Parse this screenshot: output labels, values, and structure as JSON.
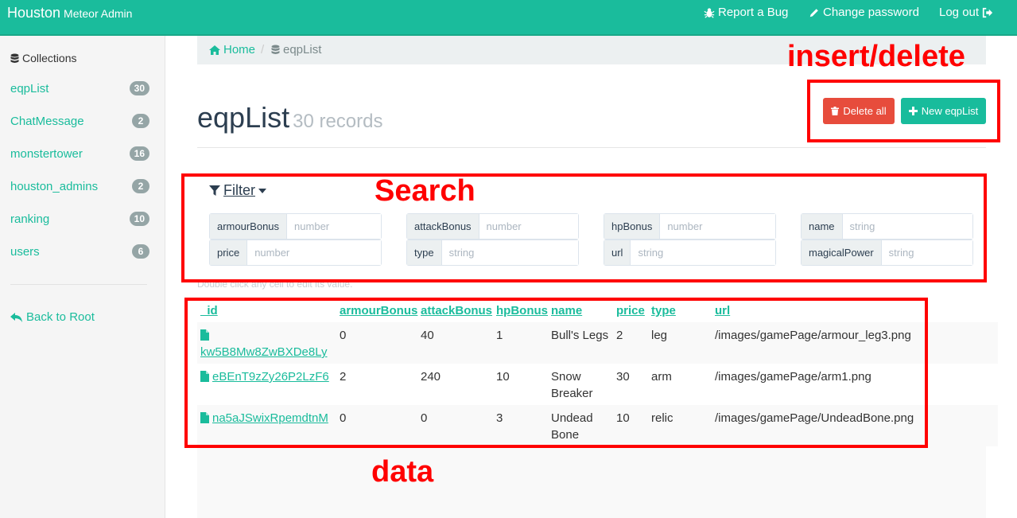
{
  "navbar": {
    "brand": "Houston",
    "brand_sub": "Meteor Admin",
    "report_bug": "Report a Bug",
    "change_password": "Change password",
    "logout": "Log out"
  },
  "sidebar": {
    "heading": "Collections",
    "items": [
      {
        "label": "eqpList",
        "count": "30"
      },
      {
        "label": "ChatMessage",
        "count": "2"
      },
      {
        "label": "monstertower",
        "count": "16"
      },
      {
        "label": "houston_admins",
        "count": "2"
      },
      {
        "label": "ranking",
        "count": "10"
      },
      {
        "label": "users",
        "count": "6"
      }
    ],
    "back_root": "Back to Root"
  },
  "breadcrumb": {
    "home": "Home",
    "separator": "/",
    "current": "eqpList"
  },
  "page": {
    "title": "eqpList",
    "record_count": "30 records"
  },
  "buttons": {
    "delete_all": "Delete all",
    "new_item": "New eqpList"
  },
  "filter": {
    "toggle_label": "Filter",
    "fields": [
      {
        "name": "armourBonus",
        "placeholder": "number"
      },
      {
        "name": "attackBonus",
        "placeholder": "number"
      },
      {
        "name": "hpBonus",
        "placeholder": "number"
      },
      {
        "name": "name",
        "placeholder": "string"
      },
      {
        "name": "price",
        "placeholder": "number"
      },
      {
        "name": "type",
        "placeholder": "string"
      },
      {
        "name": "url",
        "placeholder": "string"
      },
      {
        "name": "magicalPower",
        "placeholder": "string"
      }
    ],
    "hint": "Double click any cell to edit its value."
  },
  "table": {
    "columns": [
      "_id",
      "armourBonus",
      "attackBonus",
      "hpBonus",
      "name",
      "price",
      "type",
      "url"
    ],
    "rows": [
      {
        "_id": "kw5B8Mw8ZwBXDe8Ly",
        "armourBonus": "0",
        "attackBonus": "40",
        "hpBonus": "1",
        "name": "Bull's Legs",
        "price": "2",
        "type": "leg",
        "url": "/images/gamePage/armour_leg3.png"
      },
      {
        "_id": "eBEnT9zZy26P2LzF6",
        "armourBonus": "2",
        "attackBonus": "240",
        "hpBonus": "10",
        "name": "Snow Breaker",
        "price": "30",
        "type": "arm",
        "url": "/images/gamePage/arm1.png"
      },
      {
        "_id": "na5aJSwixRpemdtnM",
        "armourBonus": "0",
        "attackBonus": "0",
        "hpBonus": "3",
        "name": "Undead Bone",
        "price": "10",
        "type": "relic",
        "url": "/images/gamePage/UndeadBone.png"
      }
    ]
  },
  "annotations": {
    "insert_delete": "insert/delete",
    "search": "Search",
    "data": "data"
  },
  "colors": {
    "brand": "#1abc9c",
    "danger": "#e74c3c",
    "success": "#18bc9c",
    "annotation": "#ff0000",
    "badge": "#95a5a6"
  }
}
